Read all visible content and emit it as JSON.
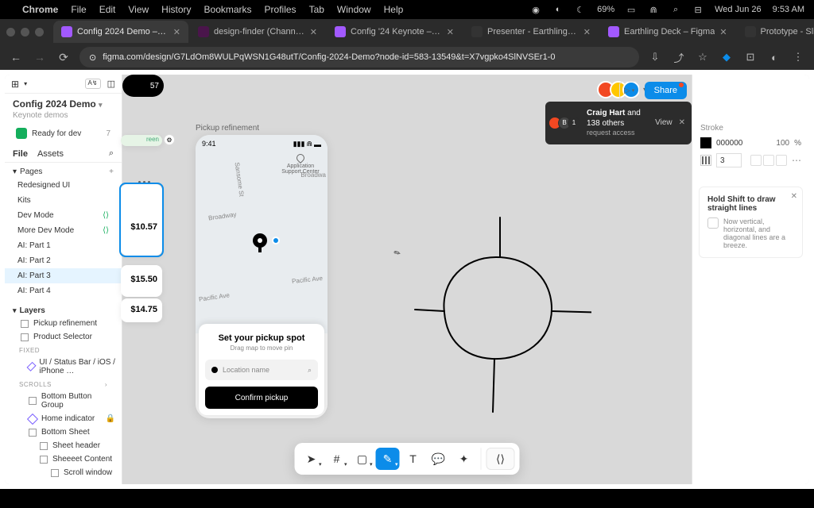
{
  "menubar": {
    "app": "Chrome",
    "items": [
      "File",
      "Edit",
      "View",
      "History",
      "Bookmarks",
      "Profiles",
      "Tab",
      "Window",
      "Help"
    ],
    "date": "Wed Jun 26",
    "time": "9:53 AM",
    "battery": "69%"
  },
  "tabs": [
    {
      "title": "Config 2024 Demo – Figma",
      "favicon": "#a259ff"
    },
    {
      "title": "design-finder (Channel) - U…",
      "favicon": "#4a154b"
    },
    {
      "title": "Config '24 Keynote – Figma",
      "favicon": "#a259ff"
    },
    {
      "title": "Presenter - Earthling Deck -…",
      "favicon": "#333"
    },
    {
      "title": "Earthling Deck – Figma",
      "favicon": "#a259ff"
    },
    {
      "title": "Prototype - Slides prototype",
      "favicon": "#333"
    }
  ],
  "url": "figma.com/design/G7LdOm8WULPqWSN1G48utT/Config-2024-Demo?node-id=583-13549&t=X7vgpko4SlNVSEr1-0",
  "leftpanel": {
    "title": "Config 2024 Demo",
    "subtitle": "Keynote demos",
    "ready_label": "Ready for dev",
    "ready_count": "7",
    "tab_file": "File",
    "tab_assets": "Assets",
    "pages_label": "Pages",
    "pages": [
      "Redesigned UI",
      "Kits",
      "Dev Mode",
      "More Dev Mode",
      "AI: Part 1",
      "AI: Part 2",
      "AI: Part 3",
      "AI: Part 4"
    ],
    "selected_page": "AI: Part 3",
    "layers_label": "Layers",
    "fixed_label": "FIXED",
    "scrolls_label": "SCROLLS",
    "layers": {
      "pickup": "Pickup refinement",
      "product": "Product Selector",
      "statusbar": "UI / Status Bar / iOS / iPhone …",
      "bottom_group": "Bottom Button Group",
      "home": "Home indicator",
      "bottom_sheet": "Bottom Sheet",
      "sheet_header": "Sheet header",
      "sheet_content": "Sheeeet Content",
      "scroll_window": "Scroll window"
    }
  },
  "canvas": {
    "frame_label": "Pickup refinement",
    "status_time": "9:41",
    "app_name": "Application Support Center",
    "prices": {
      "p1": "$10.57",
      "p2": "$15.50",
      "p3": "$14.75"
    },
    "btn_tail": "57",
    "streets": {
      "broadway": "Broadway",
      "broadwa": "Broadwa",
      "pacific1": "Pacific Ave",
      "pacific2": "Pacific Ave",
      "sansome": "Sansome St"
    },
    "sheet_title": "Set your pickup spot",
    "sheet_hint": "Drag map to move pin",
    "search_placeholder": "Location name",
    "confirm": "Confirm pickup"
  },
  "toast": {
    "name": "Craig Hart",
    "others": "and 138 others",
    "sub": "request access",
    "view": "View"
  },
  "share": "Share",
  "rightpanel": {
    "stroke_label": "Stroke",
    "color": "000000",
    "opacity": "100",
    "unit": "%",
    "weight": "3",
    "tip_title": "Hold Shift to draw straight lines",
    "tip_body": "Now vertical, horizontal, and diagonal lines are a breeze."
  }
}
